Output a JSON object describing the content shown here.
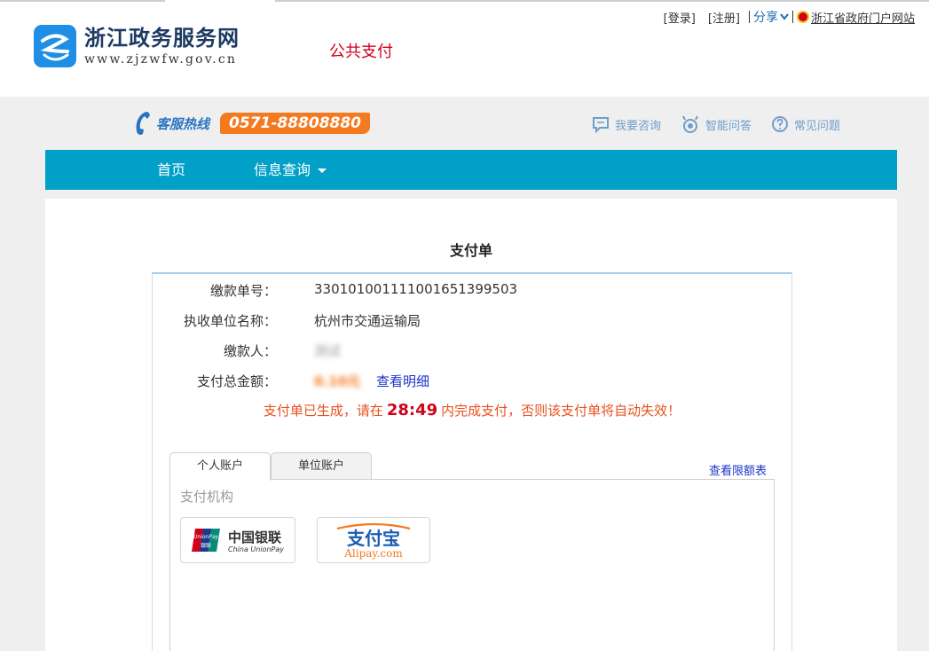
{
  "header": {
    "logo_cn": "浙江政务服务网",
    "logo_en": "www.zjzwfw.gov.cn",
    "subtitle": "公共支付",
    "links": {
      "login": "[登录]",
      "register": "[注册]",
      "share": "分享",
      "portal": "浙江省政府门户网站"
    }
  },
  "hotline": {
    "label": "客服热线",
    "number": "0571-88808880"
  },
  "helpers": {
    "consult": "我要咨询",
    "smart_qa": "智能问答",
    "faq": "常见问题"
  },
  "nav": {
    "home": "首页",
    "info_query": "信息查询"
  },
  "payment": {
    "title": "支付单",
    "fields": {
      "order_no_label": "缴款单号：",
      "order_no": "330101001111001651399503",
      "unit_label": "执收单位名称：",
      "unit": "杭州市交通运输局",
      "payer_label": "缴款人：",
      "payer": "测试",
      "amount_label": "支付总金额：",
      "amount": "0.10元",
      "detail_link": "查看明细"
    },
    "notice": {
      "prefix": "支付单已生成，请在",
      "time": "28:49",
      "suffix": "内完成支付，否则该支付单将自动失效！"
    },
    "tabs": {
      "personal": "个人账户",
      "company": "单位账户"
    },
    "limit_link": "查看限额表",
    "org_title": "支付机构",
    "orgs": {
      "unionpay_cn": "中国银联",
      "unionpay_en": "China UnionPay",
      "unionpay_badge_top": "UnionPay",
      "unionpay_badge_bottom": "银联",
      "alipay_cn": "支付宝",
      "alipay_en": "Alipay.com"
    }
  },
  "colors": {
    "nav_bg": "#00a0c9",
    "hotline_badge": "#f47a20",
    "notice_text": "#e8501e",
    "countdown": "#d0021b",
    "link": "#1b36c7"
  }
}
